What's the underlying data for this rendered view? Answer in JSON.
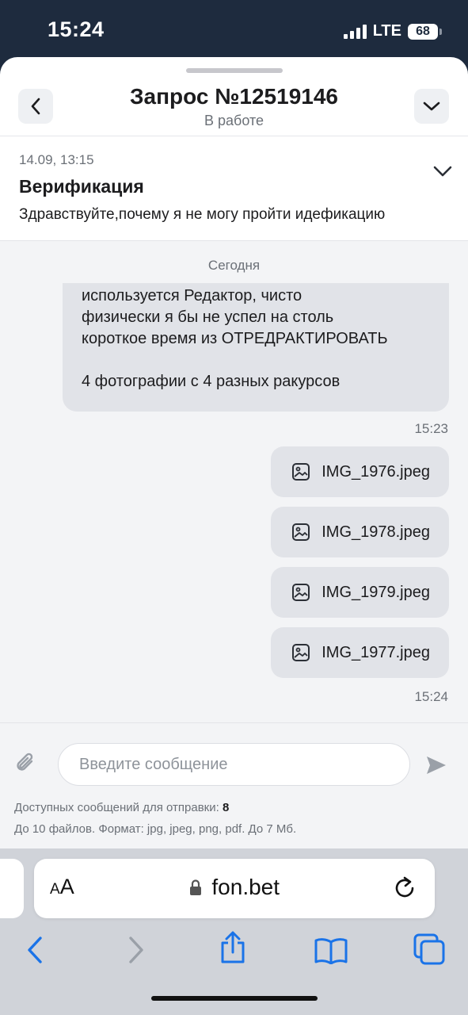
{
  "status_bar": {
    "time": "15:24",
    "network": "LTE",
    "battery": "68"
  },
  "header": {
    "title": "Запрос №12519146",
    "subtitle": "В работе"
  },
  "ticket": {
    "date": "14.09, 13:15",
    "title": "Верификация",
    "preview": "Здравствуйте,почему я не могу пройти идефикацию"
  },
  "chat": {
    "day_label": "Сегодня",
    "message_text": "что очень хорошо видно, что не\nиспользуется Редактор, чисто\nфизически я бы не успел на столь\nкороткое время из ОТРЕДРАКТИРОВАТЬ\n\n4 фотографии с 4 разных ракурсов",
    "message_time": "15:23",
    "files": [
      {
        "name": "IMG_1976.jpeg"
      },
      {
        "name": "IMG_1978.jpeg"
      },
      {
        "name": "IMG_1979.jpeg"
      },
      {
        "name": "IMG_1977.jpeg"
      }
    ],
    "files_time": "15:24"
  },
  "composer": {
    "placeholder": "Введите сообщение",
    "available_label": "Доступных сообщений для отправки:",
    "available_count": "8",
    "file_rules": "До 10 файлов. Формат: jpg, jpeg, png, pdf. До 7 Мб."
  },
  "browser": {
    "aa_small": "A",
    "aa_large": "A",
    "url": "fon.bet"
  },
  "colors": {
    "status_bg": "#1e2b3e",
    "bubble": "#e1e3e8",
    "accent": "#1a73e8"
  }
}
